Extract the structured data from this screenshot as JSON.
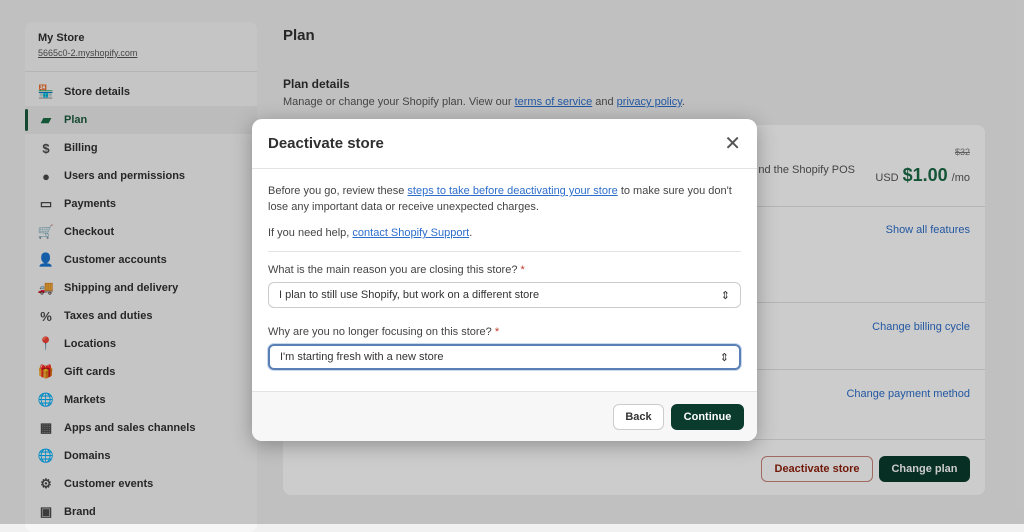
{
  "sidebar": {
    "store_name": "My Store",
    "store_url": "5665c0-2.myshopify.com",
    "items": [
      {
        "label": "Store details",
        "icon": "🏪"
      },
      {
        "label": "Plan",
        "icon": "▰"
      },
      {
        "label": "Billing",
        "icon": "$"
      },
      {
        "label": "Users and permissions",
        "icon": "●"
      },
      {
        "label": "Payments",
        "icon": "▭"
      },
      {
        "label": "Checkout",
        "icon": "🛒"
      },
      {
        "label": "Customer accounts",
        "icon": "👤"
      },
      {
        "label": "Shipping and delivery",
        "icon": "🚚"
      },
      {
        "label": "Taxes and duties",
        "icon": "%"
      },
      {
        "label": "Locations",
        "icon": "📍"
      },
      {
        "label": "Gift cards",
        "icon": "🎁"
      },
      {
        "label": "Markets",
        "icon": "🌐"
      },
      {
        "label": "Apps and sales channels",
        "icon": "▦"
      },
      {
        "label": "Domains",
        "icon": "🌐"
      },
      {
        "label": "Customer events",
        "icon": "⚙"
      },
      {
        "label": "Brand",
        "icon": "▣"
      }
    ],
    "active": "Plan"
  },
  "main": {
    "title": "Plan",
    "section_title": "Plan details",
    "desc_prefix": "Manage or change your Shopify plan. View our ",
    "terms": "terms of service",
    "and": " and ",
    "privacy": "privacy policy",
    "desc_suffix": ".",
    "plan_desc": "nd the Shopify POS",
    "old_price": "$32",
    "currency": "USD",
    "price": "$1.00",
    "period": "/mo",
    "show_features": "Show all features",
    "change_billing": "Change billing cycle",
    "change_payment": "Change payment method",
    "deactivate": "Deactivate store",
    "change_plan": "Change plan"
  },
  "modal": {
    "title": "Deactivate store",
    "text1_prefix": "Before you go, review these ",
    "text1_link": "steps to take before deactivating your store",
    "text1_suffix": " to make sure you don't lose any important data or receive unexpected charges.",
    "text2_prefix": "If you need help, ",
    "text2_link": "contact Shopify Support",
    "text2_suffix": ".",
    "q1": "What is the main reason you are closing this store?",
    "q1_value": "I plan to still use Shopify, but work on a different store",
    "q2": "Why are you no longer focusing on this store?",
    "q2_value": "I'm starting fresh with a new store",
    "required": "*",
    "back": "Back",
    "continue": "Continue"
  },
  "colors": {
    "brand_green": "#0b3b2c",
    "accent_link": "#2c6ecb",
    "danger": "#8e1f0b"
  }
}
